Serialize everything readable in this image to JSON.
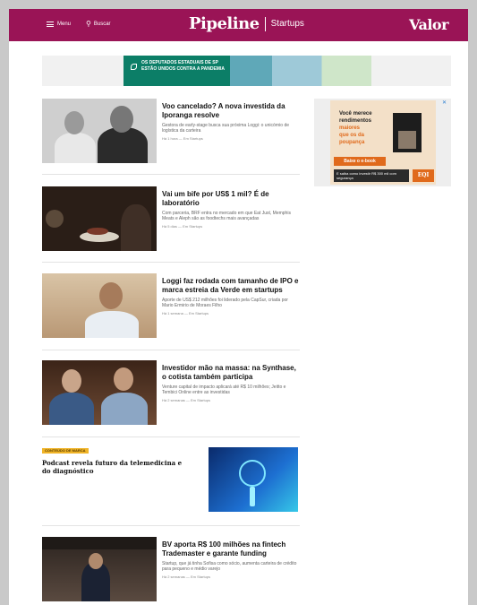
{
  "header": {
    "menu_label": "Menu",
    "search_label": "Buscar",
    "brand_main": "Pipeline",
    "brand_sub": "Startups",
    "partner_logo": "Valor"
  },
  "top_ad": {
    "text": "OS DEPUTADOS ESTADUAIS DE SP ESTÃO UNIDOS CONTRA A PANDEMIA"
  },
  "articles": [
    {
      "title": "Voo cancelado? A nova investida da Iporanga resolve",
      "description": "Gestora de early-stage busca sua próxima Loggi: o unicórnio de logística da carteira",
      "meta": "Há 1 hora — Em Startups"
    },
    {
      "title": "Vai um bife por US$ 1 mil? É de laboratório",
      "description": "Com parceria, BRF entra no mercado em que Eat Just, Memphis Meats e Aleph são as foodtechs mais avançadas",
      "meta": "Há 5 dias — Em Startups"
    },
    {
      "title": "Loggi faz rodada com tamanho de IPO e marca estreia da Verde em startups",
      "description": "Aporte de US$ 212 milhões foi liderado pela CapSur, criada por Mario Ermirio de Moraes Filho",
      "meta": "Há 1 semana — Em Startups"
    },
    {
      "title": "Investidor mão na massa: na Synthase, o cotista também participa",
      "description": "Venture capital de impacto aplicará até R$ 10 milhões; Jeitto e Tembici Online entre as investidas",
      "meta": "Há 2 semanas — Em Startups"
    },
    {
      "title": "BV aporta R$ 100 milhões na fintech Trademaster e garante funding",
      "description": "Startup, que já tinha Sofisa como sócio, aumenta carteira de crédito para pequeno e médio varejo",
      "meta": "Há 2 semanas — Em Startups"
    }
  ],
  "sponsored": {
    "badge": "CONTEÚDO DE MARCA",
    "title": "Podcast revela futuro da telemedicina e do diagnóstico"
  },
  "side_ad": {
    "line1": "Você merece",
    "line2": "rendimentos",
    "line3": "maiores",
    "line4": "que os da",
    "line5": "poupança",
    "cta": "Baixe o e-book",
    "footer": "E saiba como investir R$ 300 mil com segurança",
    "logo": "EQI",
    "close_icon": "close-icon"
  },
  "colors": {
    "header_bg": "#9a1456",
    "badge_bg": "#f0b428",
    "ad_accent": "#e06a1c"
  }
}
